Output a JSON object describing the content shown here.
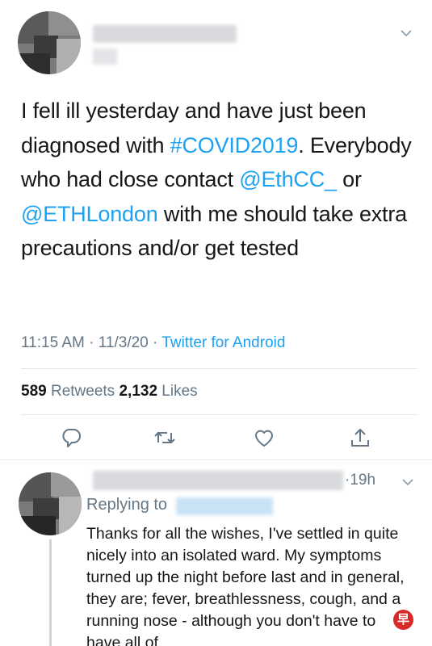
{
  "tweet": {
    "text_parts": {
      "p1": "I fell ill yesterday and have just been diagnosed with ",
      "hashtag": "#COVID2019",
      "p2": ". Everybody who had close contact ",
      "mention1": "@EthCC_",
      "p3": " or ",
      "mention2": "@ETHLondon",
      "p4": " with me should take extra precautions and/or get tested"
    },
    "time": "11:15 AM",
    "date": "11/3/20",
    "separator": "·",
    "source": "Twitter for Android"
  },
  "stats": {
    "retweets_count": "589",
    "retweets_label": "Retweets",
    "likes_count": "2,132",
    "likes_label": "Likes"
  },
  "actions": {
    "reply_icon": "reply-icon",
    "retweet_icon": "retweet-icon",
    "like_icon": "heart-icon",
    "share_icon": "share-icon"
  },
  "reply": {
    "time": "·19h",
    "replying_label": "Replying to",
    "text": "Thanks for all the wishes, I've settled in quite nicely into an isolated ward. My symptoms turned up the night before last and in general, they are; fever, breathlessness, cough, and a running nose - although you don't have to have all of"
  },
  "colors": {
    "link": "#1da1f2",
    "secondary_text": "#657786",
    "divider": "#e1e8ed"
  }
}
